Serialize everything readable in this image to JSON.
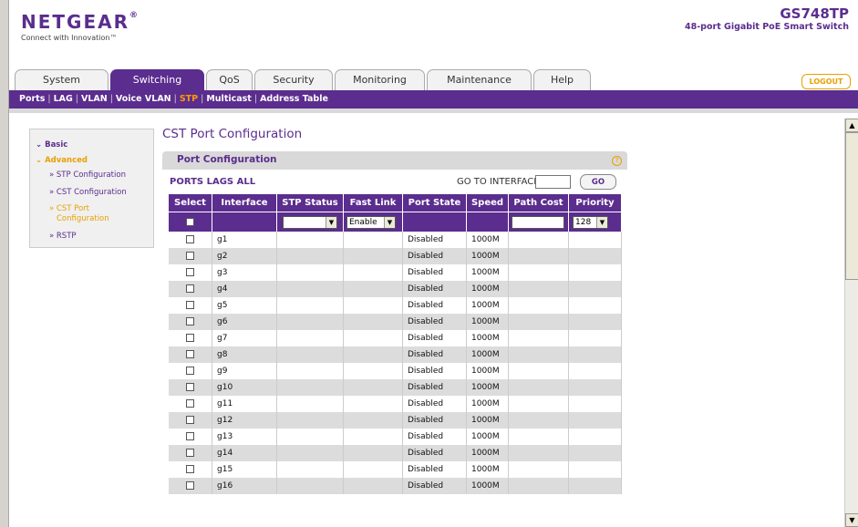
{
  "header": {
    "logo": "NETGEAR",
    "logo_mark": "®",
    "tagline": "Connect with Innovation™",
    "model": "GS748TP",
    "model_desc": "48-port Gigabit PoE Smart Switch",
    "logout": "LOGOUT"
  },
  "tabs": [
    {
      "label": "System"
    },
    {
      "label": "Switching"
    },
    {
      "label": "QoS"
    },
    {
      "label": "Security"
    },
    {
      "label": "Monitoring"
    },
    {
      "label": "Maintenance"
    },
    {
      "label": "Help"
    }
  ],
  "subnav": [
    "Ports",
    "LAG",
    "VLAN",
    "Voice VLAN",
    "STP",
    "Multicast",
    "Address Table"
  ],
  "leftmenu": {
    "basic": "Basic",
    "advanced": "Advanced",
    "items": [
      "» STP Configuration",
      "» CST Configuration",
      "» CST Port",
      "Configuration",
      "» RSTP"
    ]
  },
  "content": {
    "title": "CST Port Configuration",
    "panel_title": "Port Configuration",
    "help": "?",
    "ports_lags": "PORTS LAGS ALL",
    "goto_label": "GO TO INTERFACE",
    "go_button": "GO"
  },
  "table": {
    "headers": [
      "Select",
      "Interface",
      "STP Status",
      "Fast Link",
      "Port State",
      "Speed",
      "Path Cost",
      "Priority"
    ],
    "fast_link_value": "Enable",
    "priority_value": "128",
    "rows": [
      {
        "interface": "g1",
        "port_state": "Disabled",
        "speed": "1000M"
      },
      {
        "interface": "g2",
        "port_state": "Disabled",
        "speed": "1000M"
      },
      {
        "interface": "g3",
        "port_state": "Disabled",
        "speed": "1000M"
      },
      {
        "interface": "g4",
        "port_state": "Disabled",
        "speed": "1000M"
      },
      {
        "interface": "g5",
        "port_state": "Disabled",
        "speed": "1000M"
      },
      {
        "interface": "g6",
        "port_state": "Disabled",
        "speed": "1000M"
      },
      {
        "interface": "g7",
        "port_state": "Disabled",
        "speed": "1000M"
      },
      {
        "interface": "g8",
        "port_state": "Disabled",
        "speed": "1000M"
      },
      {
        "interface": "g9",
        "port_state": "Disabled",
        "speed": "1000M"
      },
      {
        "interface": "g10",
        "port_state": "Disabled",
        "speed": "1000M"
      },
      {
        "interface": "g11",
        "port_state": "Disabled",
        "speed": "1000M"
      },
      {
        "interface": "g12",
        "port_state": "Disabled",
        "speed": "1000M"
      },
      {
        "interface": "g13",
        "port_state": "Disabled",
        "speed": "1000M"
      },
      {
        "interface": "g14",
        "port_state": "Disabled",
        "speed": "1000M"
      },
      {
        "interface": "g15",
        "port_state": "Disabled",
        "speed": "1000M"
      },
      {
        "interface": "g16",
        "port_state": "Disabled",
        "speed": "1000M"
      }
    ]
  },
  "colors": {
    "brand_purple": "#5b2d8e",
    "accent_orange": "#e8a000",
    "row_alt": "#dcdcdc"
  }
}
